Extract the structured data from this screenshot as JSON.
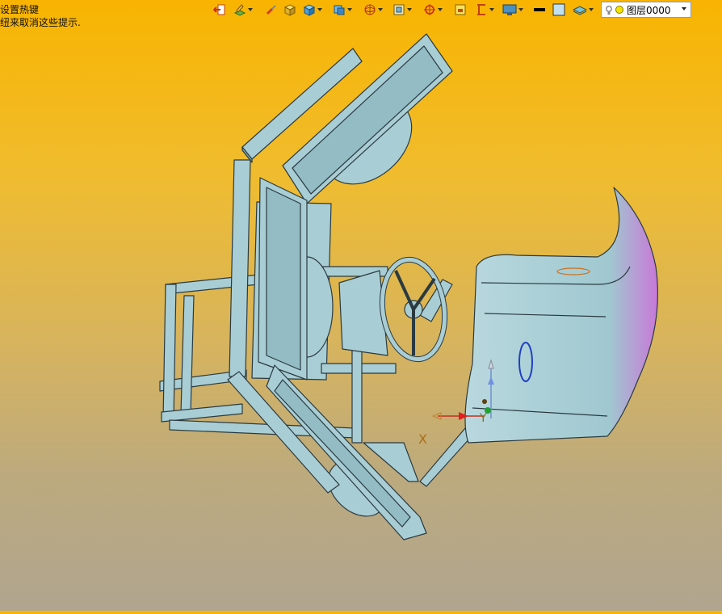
{
  "hints": {
    "line1": "设置热键",
    "line2": "纽来取消这些提示."
  },
  "layer_box": {
    "value": "图层0000"
  },
  "axes": {
    "x_label": "X",
    "y_label": "Y"
  },
  "colors": {
    "background_top": "#f8b400",
    "background_bottom": "#b0a58f",
    "model_fill": "#a9cdd4",
    "model_edge": "#2a3a40",
    "seat_highlight": "#c878d8"
  },
  "toolbar_icons": [
    "exit-icon",
    "layer-pen-icon",
    "brush-icon",
    "box-shaded-icon",
    "box-icon",
    "view-cube-icon",
    "sphere-grid-icon",
    "frame-icon",
    "target-icon",
    "fit-window-icon",
    "height-icon",
    "display-icon",
    "line-color-icon",
    "fill-color-icon",
    "layers-stack-icon"
  ]
}
